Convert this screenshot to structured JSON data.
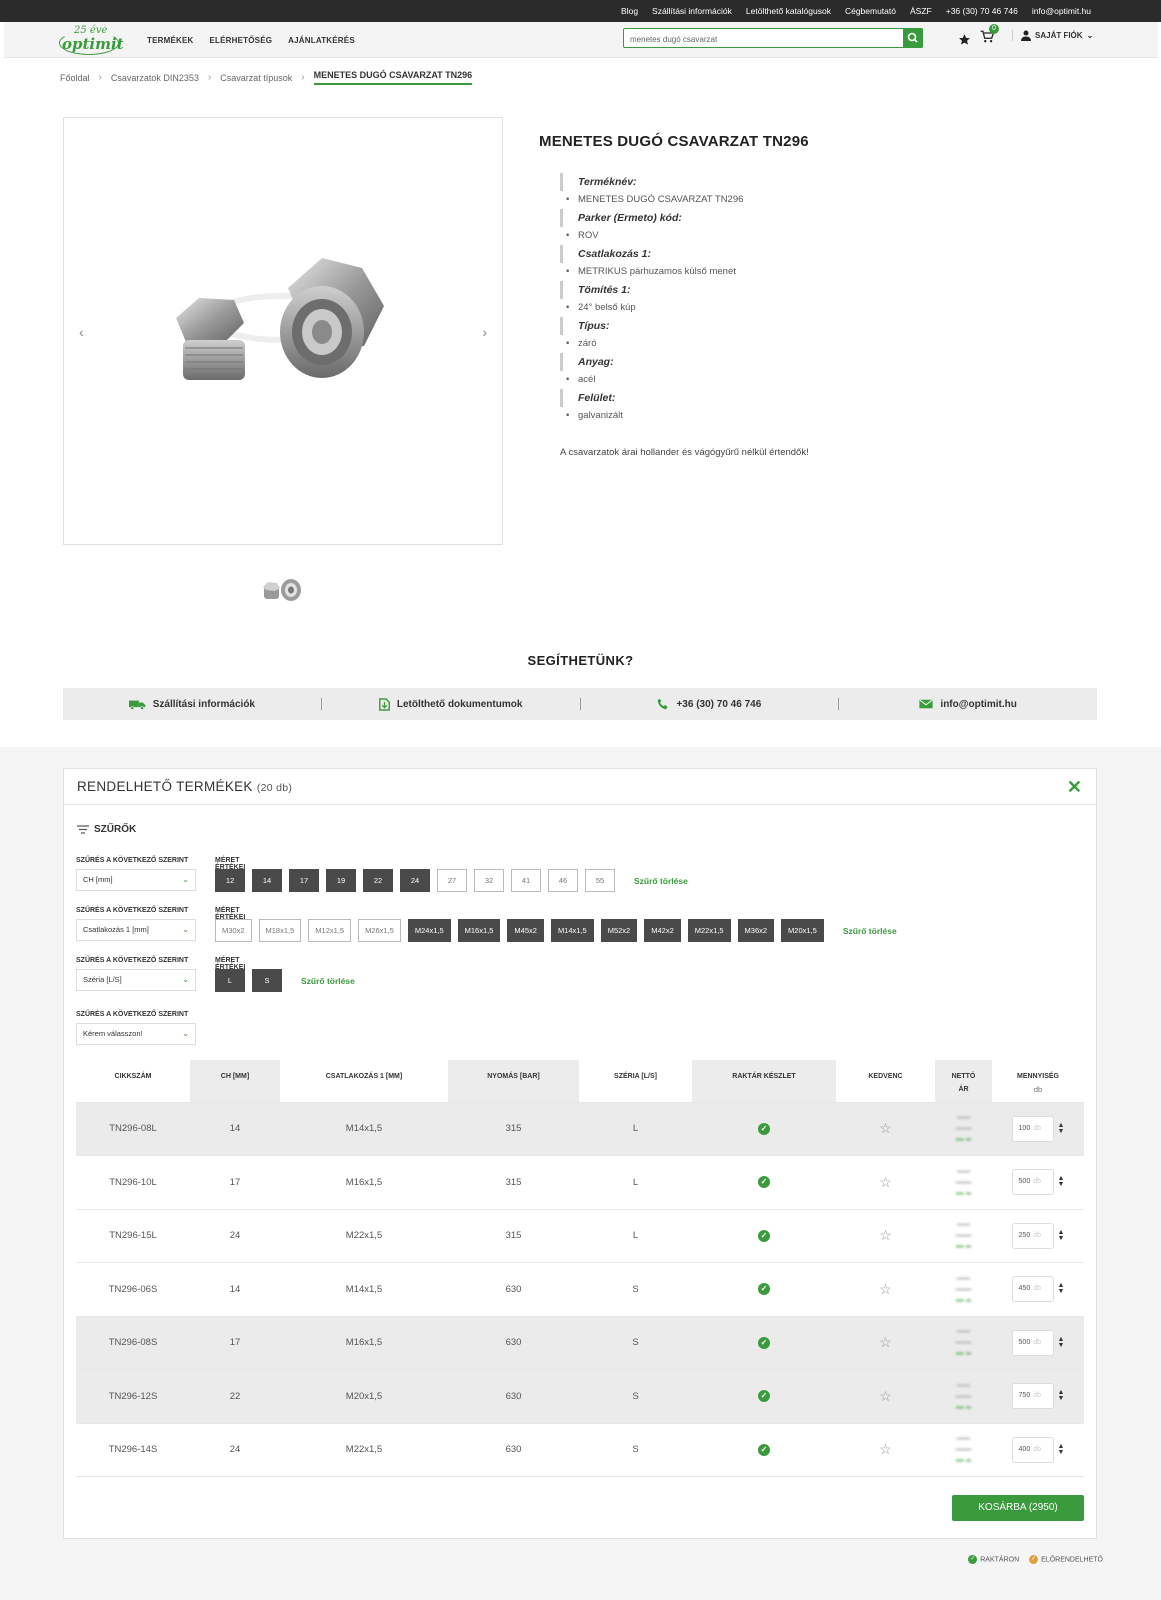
{
  "topbar": {
    "links": [
      "Blog",
      "Szállítási információk",
      "Letölthető katalógusok",
      "Cégbemutató",
      "ÁSZF",
      "+36 (30) 70 46 746",
      "info@optimit.hu"
    ]
  },
  "header": {
    "logo_top": "25 éve",
    "logo_main": "optimit",
    "nav": [
      "TERMÉKEK",
      "ELÉRHETŐSÉG",
      "AJÁNLATKÉRÉS"
    ],
    "search_value": "menetes dugó csavarzat",
    "cart_count": "0",
    "account_label": "SAJÁT FIÓK"
  },
  "breadcrumb": [
    "Főoldal",
    "Csavarzatok DIN2353",
    "Csavarzat típusok",
    "MENETES DUGÓ CSAVARZAT TN296"
  ],
  "product": {
    "title": "MENETES DUGÓ CSAVARZAT TN296",
    "specs": [
      {
        "key": "Terméknév:",
        "value": "MENETES DUGÓ CSAVARZAT TN296"
      },
      {
        "key": "Parker (Ermeto) kód:",
        "value": "ROV"
      },
      {
        "key": "Csatlakozás 1:",
        "value": "METRIKUS párhuzamos külső menet"
      },
      {
        "key": "Tömítés 1:",
        "value": "24° belső kúp"
      },
      {
        "key": "Típus:",
        "value": "záró"
      },
      {
        "key": "Anyag:",
        "value": "acél"
      },
      {
        "key": "Felület:",
        "value": "galvanizált"
      }
    ],
    "note": "A csavarzatok árai hollander és vágógyűrű nélkül értendők!"
  },
  "help": {
    "title": "SEGÍTHETÜNK?",
    "items": [
      "Szállítási információk",
      "Letölthető dokumentumok",
      "+36 (30) 70 46 746",
      "info@optimit.hu"
    ]
  },
  "orderable": {
    "title": "RENDELHETŐ TERMÉKEK",
    "count": "(20 db)",
    "filters_label": "SZŰRŐK",
    "filter_by_label": "SZŰRÉS A KÖVETKEZŐ SZERINT",
    "values_label": "MÉRET ÉRTÉKEI",
    "clear_label": "Szűrő törlése",
    "filters": [
      {
        "select": "CH [mm]",
        "chips": [
          {
            "v": "12",
            "on": true
          },
          {
            "v": "14",
            "on": true
          },
          {
            "v": "17",
            "on": true
          },
          {
            "v": "19",
            "on": true
          },
          {
            "v": "22",
            "on": true
          },
          {
            "v": "24",
            "on": true
          },
          {
            "v": "27",
            "on": false
          },
          {
            "v": "32",
            "on": false
          },
          {
            "v": "41",
            "on": false
          },
          {
            "v": "46",
            "on": false
          },
          {
            "v": "55",
            "on": false
          }
        ]
      },
      {
        "select": "Csatlakozás 1 [mm]",
        "chips": [
          {
            "v": "M30x2",
            "on": false
          },
          {
            "v": "M18x1,5",
            "on": false
          },
          {
            "v": "M12x1,5",
            "on": false
          },
          {
            "v": "M26x1,5",
            "on": false
          },
          {
            "v": "M24x1,5",
            "on": true
          },
          {
            "v": "M16x1,5",
            "on": true
          },
          {
            "v": "M45x2",
            "on": true
          },
          {
            "v": "M14x1,5",
            "on": true
          },
          {
            "v": "M52x2",
            "on": true
          },
          {
            "v": "M42x2",
            "on": true
          },
          {
            "v": "M22x1,5",
            "on": true
          },
          {
            "v": "M36x2",
            "on": true
          },
          {
            "v": "M20x1,5",
            "on": true
          }
        ]
      },
      {
        "select": "Széria [L/S]",
        "chips": [
          {
            "v": "L",
            "on": true
          },
          {
            "v": "S",
            "on": true
          }
        ]
      }
    ],
    "empty_select": "Kérem válasszon!",
    "columns": [
      "CIKKSZÁM",
      "CH [MM]",
      "CSATLAKOZÁS 1 [MM]",
      "NYOMÁS [BAR]",
      "SZÉRIA [L/S]",
      "RAKTÁR KÉSZLET",
      "KEDVENC",
      "NETTÓ",
      "ÁR",
      "MENNYISÉG",
      "db"
    ],
    "rows": [
      {
        "code": "TN296-08L",
        "ch": "14",
        "conn": "M14x1,5",
        "pressure": "315",
        "series": "L",
        "qty": "100"
      },
      {
        "code": "TN296-10L",
        "ch": "17",
        "conn": "M16x1,5",
        "pressure": "315",
        "series": "L",
        "qty": "500"
      },
      {
        "code": "TN296-15L",
        "ch": "24",
        "conn": "M22x1,5",
        "pressure": "315",
        "series": "L",
        "qty": "250"
      },
      {
        "code": "TN296-06S",
        "ch": "14",
        "conn": "M14x1,5",
        "pressure": "630",
        "series": "S",
        "qty": "450"
      },
      {
        "code": "TN296-08S",
        "ch": "17",
        "conn": "M16x1,5",
        "pressure": "630",
        "series": "S",
        "qty": "500"
      },
      {
        "code": "TN296-12S",
        "ch": "22",
        "conn": "M20x1,5",
        "pressure": "630",
        "series": "S",
        "qty": "750"
      },
      {
        "code": "TN296-14S",
        "ch": "24",
        "conn": "M22x1,5",
        "pressure": "630",
        "series": "S",
        "qty": "400"
      }
    ],
    "qty_unit": "db",
    "cart_button": "KOSÁRBA (2950)"
  },
  "legend": {
    "in_stock": "RAKTÁRON",
    "preorder": "ELŐRENDELHETŐ"
  },
  "colors": {
    "accent": "#3a9b3d",
    "chip_active": "#4a4a4a",
    "preorder": "#e0a040"
  }
}
